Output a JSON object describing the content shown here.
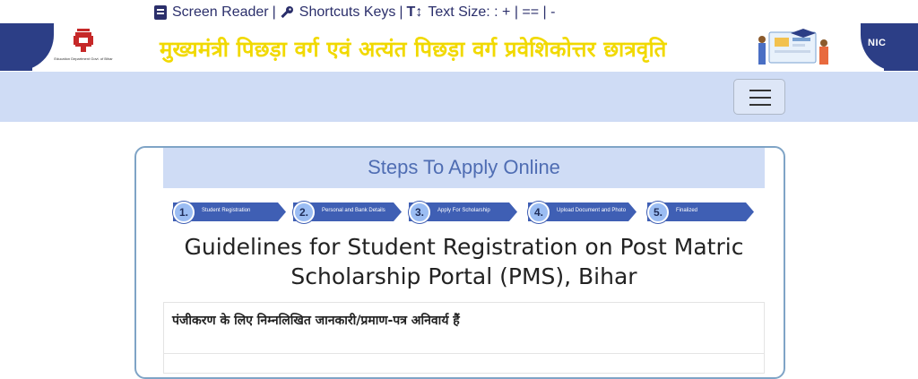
{
  "accessibility": {
    "screen_reader": "Screen Reader",
    "shortcuts": "Shortcuts Keys",
    "text_size": "Text Size: : + | == |  -",
    "sep": "|"
  },
  "header": {
    "title": "मुख्यमंत्री पिछड़ा वर्ग एवं अत्यंत पिछड़ा वर्ग प्रवेशिकोत्तर छात्रवृति",
    "emblem_caption": "Education Department Govt. of Bihar",
    "nic_logo": "NIC",
    "colors": {
      "banner": "#2c3e86",
      "title": "#f1d900",
      "nav": "#cfdcf5"
    }
  },
  "nav": {
    "menu_icon": "hamburger-icon"
  },
  "card": {
    "title": "Steps To Apply Online",
    "steps": [
      {
        "num": "1.",
        "label": "Student Registration"
      },
      {
        "num": "2.",
        "label": "Personal and Bank Details"
      },
      {
        "num": "3.",
        "label": "Apply For Scholarship"
      },
      {
        "num": "4.",
        "label": "Upload Document and Photo"
      },
      {
        "num": "5.",
        "label": "Finalized"
      }
    ],
    "guideline_line1": "Guidelines for Student Registration on Post Matric",
    "guideline_line2": "Scholarship Portal (PMS), Bihar",
    "info": "पंजीकरण के लिए निम्नलिखित जानकारी/प्रमाण-पत्र अनिवार्य हैं"
  }
}
